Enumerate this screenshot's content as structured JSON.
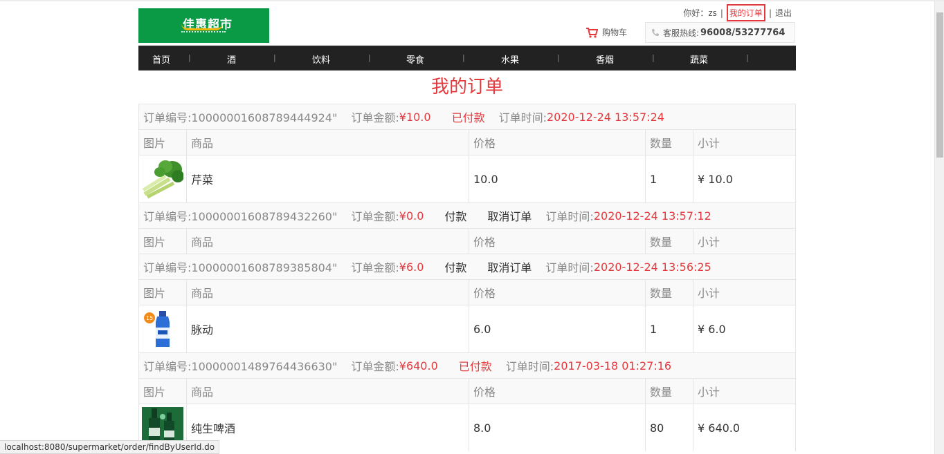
{
  "header": {
    "logo_text": "佳惠超市",
    "greeting": "你好：zs",
    "my_orders": "我的订单",
    "logout": "退出",
    "cart": "购物车",
    "hotline_label": "客服热线:",
    "hotline_number": "96008/53277764"
  },
  "nav": {
    "items": [
      "首页",
      "酒",
      "饮料",
      "零食",
      "水果",
      "香烟",
      "蔬菜"
    ]
  },
  "page_title": "我的订单",
  "columns": {
    "image": "图片",
    "product": "商品",
    "price": "价格",
    "quantity": "数量",
    "subtotal": "小计"
  },
  "orders": [
    {
      "no_label": "订单编号:10000001608789444924\"",
      "amount_label": "订单金额:",
      "amount": "¥10.0",
      "status": "已付款",
      "time_label": "订单时间:",
      "time": "2020-12-24 13:57:24",
      "items": [
        {
          "name": "芹菜",
          "price": "10.0",
          "qty": "1",
          "subtotal": "¥ 10.0",
          "icon": "celery-image"
        }
      ]
    },
    {
      "no_label": "订单编号:10000001608789432260\"",
      "amount_label": "订单金额:",
      "amount": "¥0.0",
      "pay": "付款",
      "cancel": "取消订单",
      "time_label": "订单时间:",
      "time": "2020-12-24 13:57:12",
      "items": []
    },
    {
      "no_label": "订单编号:10000001608789385804\"",
      "amount_label": "订单金额:",
      "amount": "¥6.0",
      "pay": "付款",
      "cancel": "取消订单",
      "time_label": "订单时间:",
      "time": "2020-12-24 13:56:25",
      "items": [
        {
          "name": "脉动",
          "price": "6.0",
          "qty": "1",
          "subtotal": "¥ 6.0",
          "icon": "sports-drink-image"
        }
      ]
    },
    {
      "no_label": "订单编号:10000001489764436630\"",
      "amount_label": "订单金额:",
      "amount": "¥640.0",
      "status": "已付款",
      "time_label": "订单时间:",
      "time": "2017-03-18 01:27:16",
      "items": [
        {
          "name": "纯生啤酒",
          "price": "8.0",
          "qty": "80",
          "subtotal": "¥ 640.0",
          "icon": "beer-image"
        }
      ]
    }
  ],
  "status_bar_url": "localhost:8080/supermarket/order/findByUserId.do",
  "colors": {
    "accent": "#e4393c",
    "brand": "#0a9a46",
    "nav": "#222222"
  }
}
